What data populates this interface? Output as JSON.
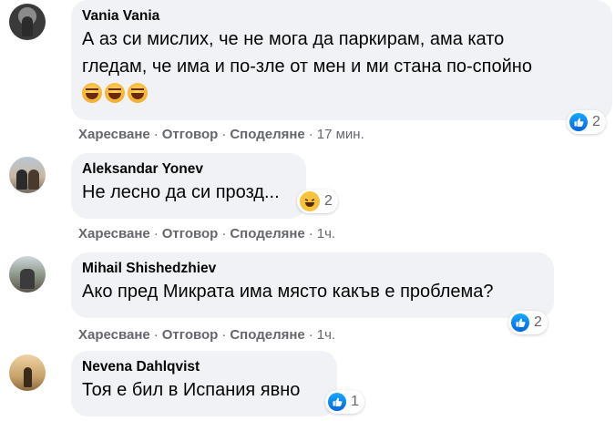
{
  "comments": [
    {
      "author": "Vania Vania",
      "text_line1": "А аз си мислих, че не мога да паркирам, ама като",
      "text_line2": "гледам, че има и по-зле от мен и ми стана по-спойно",
      "emojis": [
        "laughing-emoji",
        "laughing-emoji",
        "laughing-emoji"
      ],
      "reaction_icon": "like-icon",
      "reaction_count": "2",
      "time": "17 мин."
    },
    {
      "author": "Aleksandar Yonev",
      "text_line1": "Не лесно да си прозд...",
      "reaction_icon": "haha-icon",
      "reaction_count": "2",
      "time": "1ч."
    },
    {
      "author": "Mihail Shishedzhiev",
      "text_line1": "Ако пред Микрата има място какъв е проблема?",
      "reaction_icon": "like-icon",
      "reaction_count": "2",
      "time": "1ч."
    },
    {
      "author": "Nevena Dahlqvist",
      "text_line1": "Тоя е бил в Испания явно",
      "reaction_icon": "like-icon",
      "reaction_count": "1"
    }
  ],
  "actions": {
    "like": "Харесване",
    "reply": "Отговор",
    "share": "Споделяне",
    "separator": "·"
  },
  "colors": {
    "bubble": "#f0f2f5",
    "meta_text": "#65676b",
    "like_blue": "#0866ff",
    "haha_yellow": "#f7c33d"
  }
}
